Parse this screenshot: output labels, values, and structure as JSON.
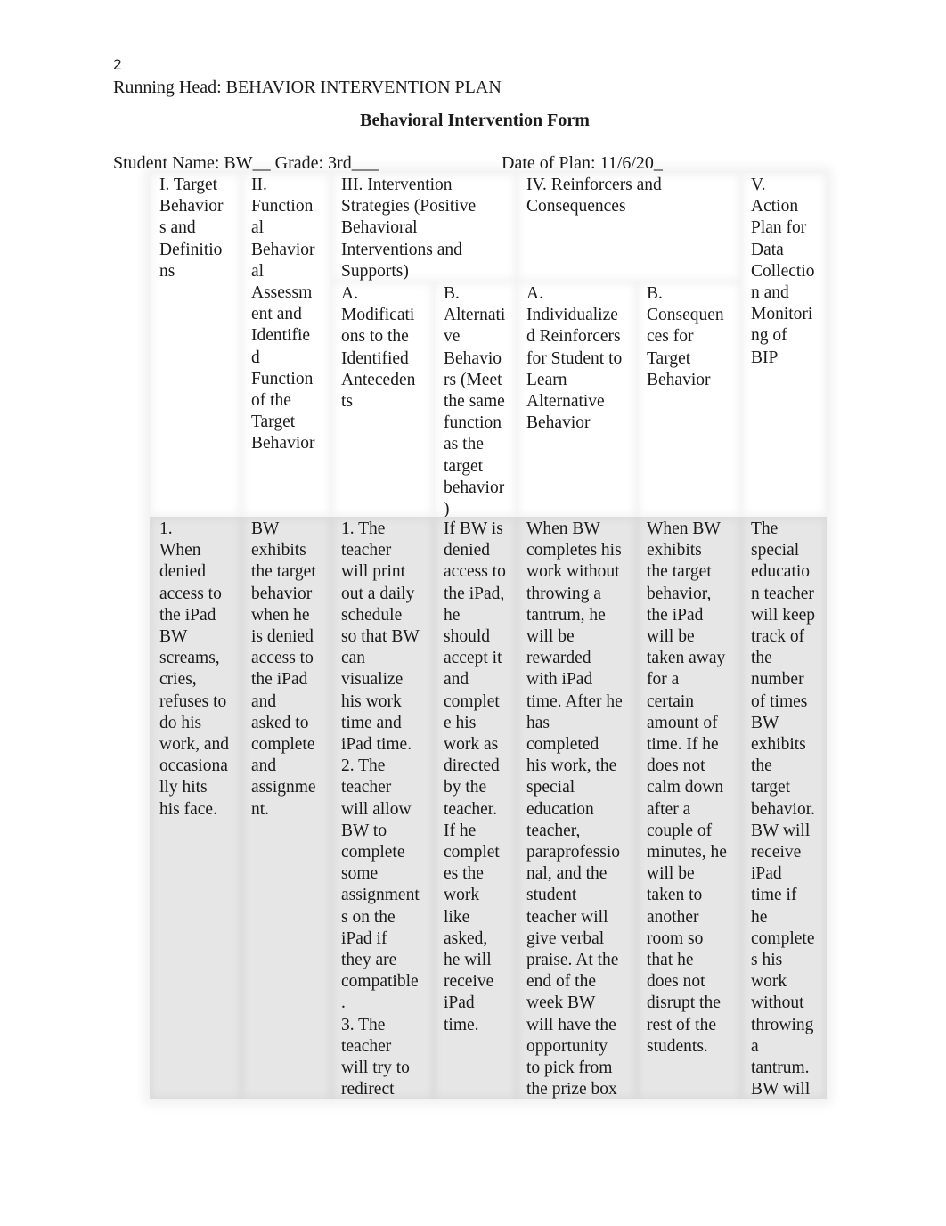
{
  "page_number": "2",
  "running_head": "Running Head: BEHAVIOR INTERVENTION PLAN",
  "form_title": "Behavioral Intervention Form",
  "student_line": "Student Name: BW__ Grade: 3rd___",
  "date_line": "Date of Plan: 11/6/20_",
  "table": {
    "headers": {
      "col1": "I. Target\nBehavior\ns and\nDefinitio\nns",
      "col2": "II.\nFunction\nal\nBehavior\nal\nAssessm\nent and\nIdentifie\nd\nFunction\nof the\nTarget\nBehavior",
      "col3": "III. Intervention\nStrategies (Positive\nBehavioral\nInterventions and\nSupports)",
      "col3a": "A.\nModificati\nons to the\nIdentified\nAnteceden\nts",
      "col3b": "B.\nAlternati\nve\nBehavio\nrs (Meet\nthe same\nfunction\nas the\ntarget\nbehavior\n)",
      "col4": "IV. Reinforcers and\nConsequences",
      "col4a": "A.\nIndividualize\nd Reinforcers\nfor Student to\nLearn\nAlternative\nBehavior",
      "col4b": "B.\nConsequen\nces for\nTarget\nBehavior",
      "col5": "V.\nAction\nPlan for\nData\nCollectio\nn and\nMonitori\nng of\nBIP"
    },
    "row": {
      "col1": "1.\nWhen\ndenied\naccess to\nthe iPad\nBW\nscreams,\ncries,\nrefuses to\ndo his\nwork, and\noccasiona\nlly hits\nhis face.",
      "col2": "BW\nexhibits\nthe target\nbehavior\nwhen he\nis denied\naccess to\nthe iPad\nand\nasked to\ncomplete\nand\nassignme\nnt.",
      "col3a": "1. The\nteacher\nwill print\nout a daily\nschedule\nso that BW\ncan\nvisualize\nhis work\ntime and\niPad time.\n2. The\nteacher\nwill allow\nBW to\ncomplete\nsome\nassignment\ns on the\niPad if\nthey are\ncompatible\n.\n3. The\nteacher\nwill try to\nredirect",
      "col3b": "If BW is\ndenied\naccess to\nthe iPad,\nhe\nshould\naccept it\nand\ncomplet\ne his\nwork as\ndirected\nby the\nteacher.\nIf he\ncomplet\nes the\nwork\nlike\nasked,\nhe will\nreceive\niPad\ntime.",
      "col4a": "When BW\ncompletes his\nwork without\nthrowing a\ntantrum, he\nwill be\nrewarded\nwith iPad\ntime. After he\nhas\ncompleted\nhis work, the\nspecial\neducation\nteacher,\nparaprofessio\nnal, and the\nstudent\nteacher will\ngive verbal\npraise. At the\nend of the\nweek BW\nwill have the\nopportunity\nto pick from\nthe prize box",
      "col4b": "When BW\nexhibits\nthe target\nbehavior,\nthe iPad\nwill be\ntaken away\nfor a\ncertain\namount of\ntime. If he\ndoes not\ncalm down\nafter a\ncouple of\nminutes, he\nwill be\ntaken to\nanother\nroom so\nthat he\ndoes not\ndisrupt the\nrest of the\nstudents.",
      "col5": "The\nspecial\neducatio\nn teacher\nwill keep\ntrack of\nthe\nnumber\nof times\nBW\nexhibits\nthe\ntarget\nbehavior.\nBW will\nreceive\niPad\ntime if\nhe\ncomplete\ns his\nwork\nwithout\nthrowing\na\ntantrum.\nBW will"
    }
  }
}
